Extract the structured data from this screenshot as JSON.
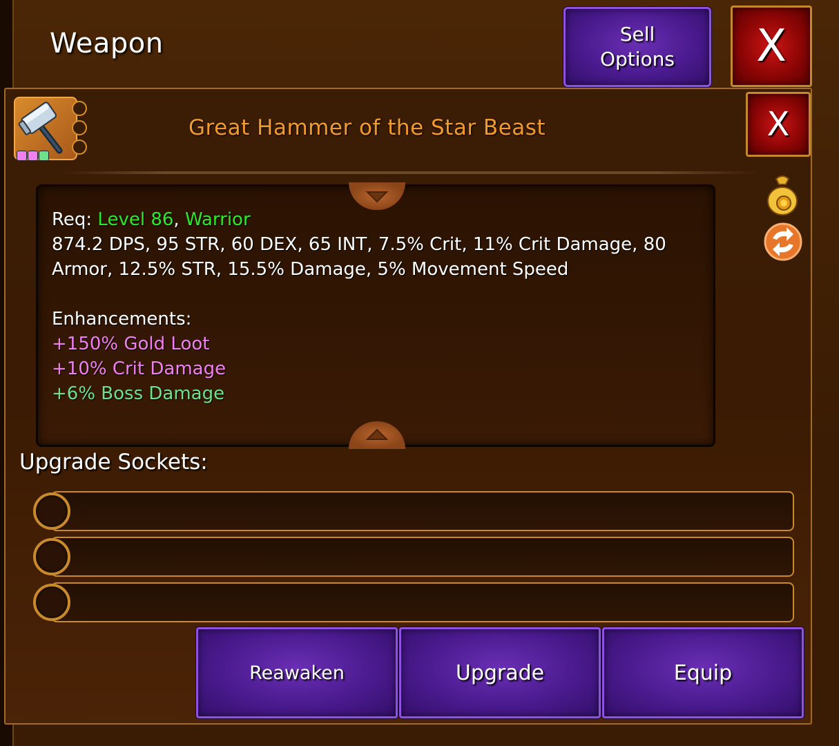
{
  "window": {
    "title": "Weapon",
    "sell_line1": "Sell",
    "sell_line2": "Options",
    "close_label": "X"
  },
  "item": {
    "name": "Great Hammer of the Star Beast",
    "close_label": "X",
    "icon": "hammer-icon",
    "gem_colors": [
      "#f080f0",
      "#f080f0",
      "#6ee28a"
    ]
  },
  "stats": {
    "req_label": "Req: ",
    "req_level": "Level 86",
    "req_sep": ", ",
    "req_class": "Warrior",
    "line1": "874.2 DPS, 95 STR, 60 DEX, 65 INT, 7.5% Crit, 11% Crit Damage, 80",
    "line2": "Armor, 12.5% STR, 15.5% Damage, 5% Movement Speed",
    "enh_title": "Enhancements:",
    "enhancements": [
      "+150% Gold Loot",
      "+10% Crit Damage",
      "+6% Boss Damage"
    ]
  },
  "side_icons": [
    "gold-bag-icon",
    "swap-arrows-icon"
  ],
  "sockets": {
    "label": "Upgrade Sockets:",
    "count": 3
  },
  "actions": {
    "reawaken": "Reawaken",
    "upgrade": "Upgrade",
    "equip": "Equip"
  },
  "colors": {
    "item_name": "#f09a2f",
    "requirement": "#2ee82e",
    "enhancement_pink": "#f07ff0",
    "enhancement_green": "#6ee28a",
    "button_purple": "#4a1a8e",
    "button_red": "#8c0505"
  }
}
